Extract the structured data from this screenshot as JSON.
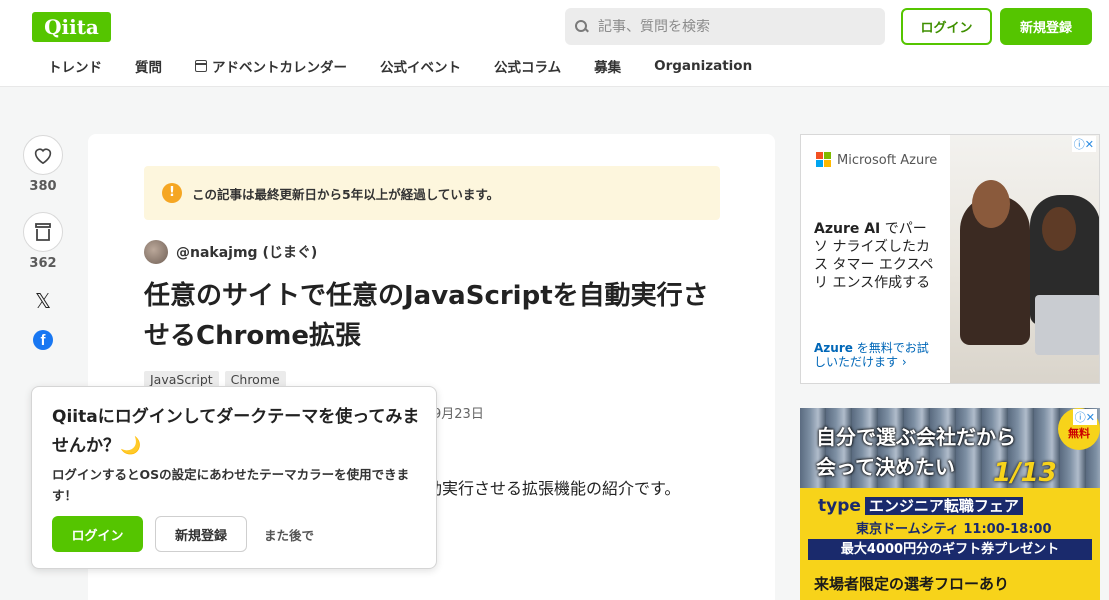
{
  "header": {
    "logo": "Qiita",
    "search_placeholder": "記事、質問を検索",
    "login_label": "ログイン",
    "signup_label": "新規登録"
  },
  "nav": {
    "items": [
      "トレンド",
      "質問",
      "アドベントカレンダー",
      "公式イベント",
      "公式コラム",
      "募集",
      "Organization"
    ]
  },
  "rail": {
    "like_count": "380",
    "stock_count": "362",
    "x_label": "𝕏",
    "fb_label": "f"
  },
  "article": {
    "notice": "この記事は最終更新日から5年以上が経過しています。",
    "notice_icon": "!",
    "author": "@nakajmg (じまぐ)",
    "title": "任意のサイトで任意のJavaScriptを自動実行させるChrome拡張",
    "tags": [
      "JavaScript",
      "Chrome"
    ],
    "date": "9月23日",
    "intro": "動実行させる拡張機能の紹介です。"
  },
  "popup": {
    "title": "Qiitaにログインしてダークテーマを使ってみませんか？",
    "moon": "🌙",
    "description": "ログインするとOSの設定にあわせたテーマカラーを使用できます！",
    "login_label": "ログイン",
    "signup_label": "新規登録",
    "later_label": "また後で"
  },
  "ad_azure": {
    "brand": "Microsoft Azure",
    "body_bold": "Azure AI",
    "body_rest": " でパーソ ナライズしたカス タマー エクスペリ エンス作成する",
    "cta_bold": "Azure",
    "cta_rest": " を無料でお試しいただけます ›",
    "adchoice": "ⓘ✕"
  },
  "ad_type": {
    "headline_1": "自分で選ぶ会社だから",
    "headline_2": "会って決めたい",
    "free": "無料",
    "date": "1/13",
    "brand": "type",
    "fair": "エンジニア転職フェア",
    "venue": "東京ドームシティ 11:00-18:00",
    "gift": "最大4000円分のギフト券プレゼント",
    "flow": "来場者限定の選考フローあり",
    "adchoice": "ⓘ✕"
  }
}
